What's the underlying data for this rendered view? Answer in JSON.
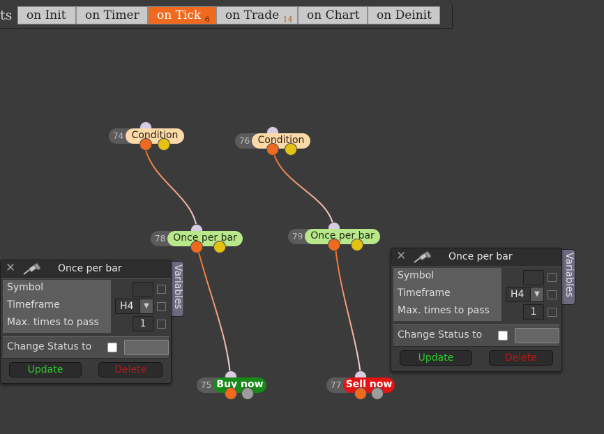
{
  "tabs": {
    "prefix": "ts",
    "items": [
      {
        "label": "on Init",
        "badge": ""
      },
      {
        "label": "on Timer",
        "badge": ""
      },
      {
        "label": "on Tick",
        "badge": "6"
      },
      {
        "label": "on Trade",
        "badge": "14"
      },
      {
        "label": "on Chart",
        "badge": ""
      },
      {
        "label": "on Deinit",
        "badge": ""
      }
    ],
    "active": "on Tick"
  },
  "nodes": [
    {
      "id": "74",
      "label": "Condition",
      "kind": "condition"
    },
    {
      "id": "76",
      "label": "Condition",
      "kind": "condition"
    },
    {
      "id": "78",
      "label": "Once per bar",
      "kind": "once-per-bar"
    },
    {
      "id": "79",
      "label": "Once per bar",
      "kind": "once-per-bar"
    },
    {
      "id": "75",
      "label": "Buy now",
      "kind": "buy"
    },
    {
      "id": "77",
      "label": "Sell now",
      "kind": "sell"
    }
  ],
  "panels": [
    {
      "title": "Once per bar",
      "rows": [
        {
          "label": "Symbol",
          "value": ""
        },
        {
          "label": "Timeframe",
          "value": "H4"
        },
        {
          "label": "Max. times to pass",
          "value": "1"
        }
      ],
      "status_label": "Change Status to",
      "update_label": "Update",
      "delete_label": "Delete",
      "side_tab": "Variables"
    },
    {
      "title": "Once per bar",
      "rows": [
        {
          "label": "Symbol",
          "value": ""
        },
        {
          "label": "Timeframe",
          "value": "H4"
        },
        {
          "label": "Max. times to pass",
          "value": "1"
        }
      ],
      "status_label": "Change Status to",
      "update_label": "Update",
      "delete_label": "Delete",
      "side_tab": "Variables"
    }
  ],
  "colors": {
    "canvas": "#3b3b3b",
    "active_tab": "#ef6a1e",
    "condition": "#fbd9a8",
    "once_per_bar": "#b8e88a",
    "buy": "#178a17",
    "sell": "#e21414",
    "wire": "#ef6a1e"
  }
}
